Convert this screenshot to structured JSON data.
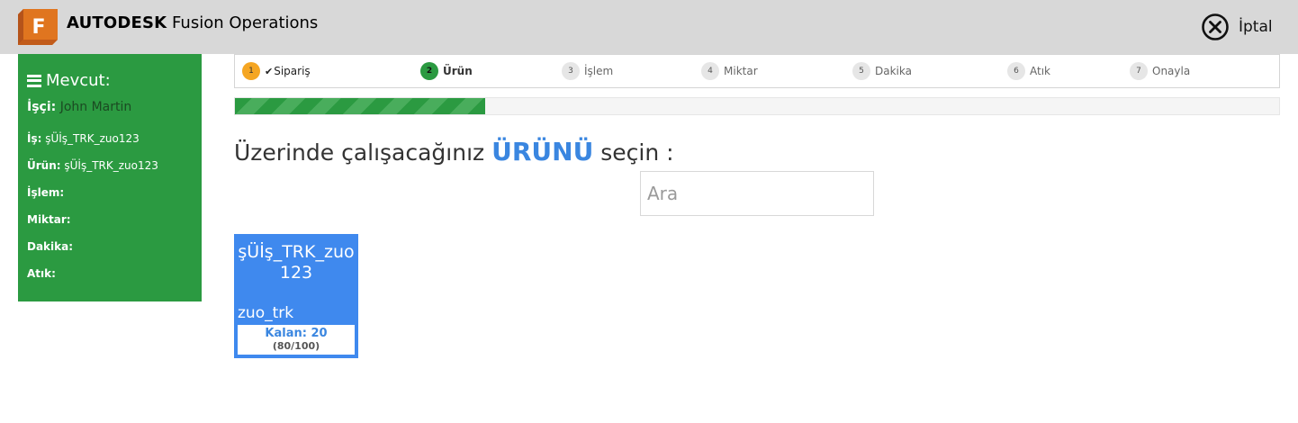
{
  "header": {
    "brand_bold": "AUTODESK",
    "brand_rest": " Fusion Operations",
    "logo_letter": "F",
    "cancel_label": "İptal",
    "cancel_icon": "close-circle-icon"
  },
  "colors": {
    "header_bg": "#d8d8d8",
    "sidebar_bg": "#2b9a41",
    "accent_blue": "#3f89ee",
    "step_done": "#f5a623",
    "step_active": "#2b9a41"
  },
  "sidebar": {
    "title": "Mevcut:",
    "title_icon": "hamburger-icon",
    "worker_label": "İşçi:",
    "worker_value": "John Martin",
    "rows": [
      {
        "label": "İş:",
        "value": "şÜİş_TRK_zuo123"
      },
      {
        "label": "Ürün:",
        "value": "şÜİş_TRK_zuo123"
      },
      {
        "label": "İşlem:",
        "value": ""
      },
      {
        "label": "Miktar:",
        "value": ""
      },
      {
        "label": "Dakika:",
        "value": ""
      },
      {
        "label": "Atık:",
        "value": ""
      }
    ]
  },
  "steps": [
    {
      "num": "1",
      "label": "Sipariş",
      "state": "done"
    },
    {
      "num": "2",
      "label": "Ürün",
      "state": "active"
    },
    {
      "num": "3",
      "label": "İşlem",
      "state": "pending"
    },
    {
      "num": "4",
      "label": "Miktar",
      "state": "pending"
    },
    {
      "num": "5",
      "label": "Dakika",
      "state": "pending"
    },
    {
      "num": "6",
      "label": "Atık",
      "state": "pending"
    },
    {
      "num": "7",
      "label": "Onayla",
      "state": "pending"
    }
  ],
  "progress": {
    "fraction": 0.24
  },
  "prompt": {
    "before": "Üzerinde çalışacağınız ",
    "emphasis": "ÜRÜNÜ",
    "after": " seçin :"
  },
  "search": {
    "placeholder": "Ara",
    "value": ""
  },
  "products": [
    {
      "name": "şÜİş_TRK_zuo123",
      "code": "zuo_trk",
      "remaining": "Kalan: 20",
      "quantity": "(80/100)"
    }
  ]
}
